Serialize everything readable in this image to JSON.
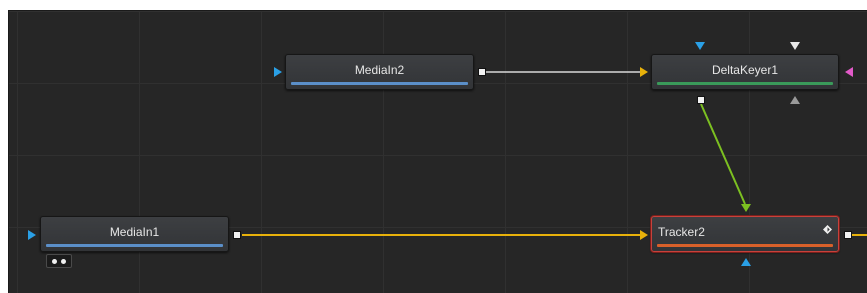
{
  "colors": {
    "background": "#262626",
    "grid": "#303030",
    "link_white": "#d9d9d9",
    "link_yellow": "#e8b10a",
    "link_green": "#7cc021",
    "input_blue": "#2aa0e6",
    "input_magenta": "#e25ac8",
    "underline_blue": "#5b8fc9",
    "underline_green": "#3a9a5a",
    "underline_orange": "#d8602a",
    "selected_border": "#c8413b"
  },
  "nodes": {
    "mediain2": {
      "label": "MediaIn2",
      "underline_color": "#5b8fc9"
    },
    "deltakeyer1": {
      "label": "DeltaKeyer1",
      "underline_color": "#3a9a5a"
    },
    "mediain1": {
      "label": "MediaIn1",
      "underline_color": "#5b8fc9"
    },
    "tracker2": {
      "label": "Tracker2",
      "underline_color": "#d8602a",
      "selected": true
    }
  },
  "icons": {
    "diamond": "keyframe-diamond-icon",
    "pip": "view-indicator-icon"
  }
}
